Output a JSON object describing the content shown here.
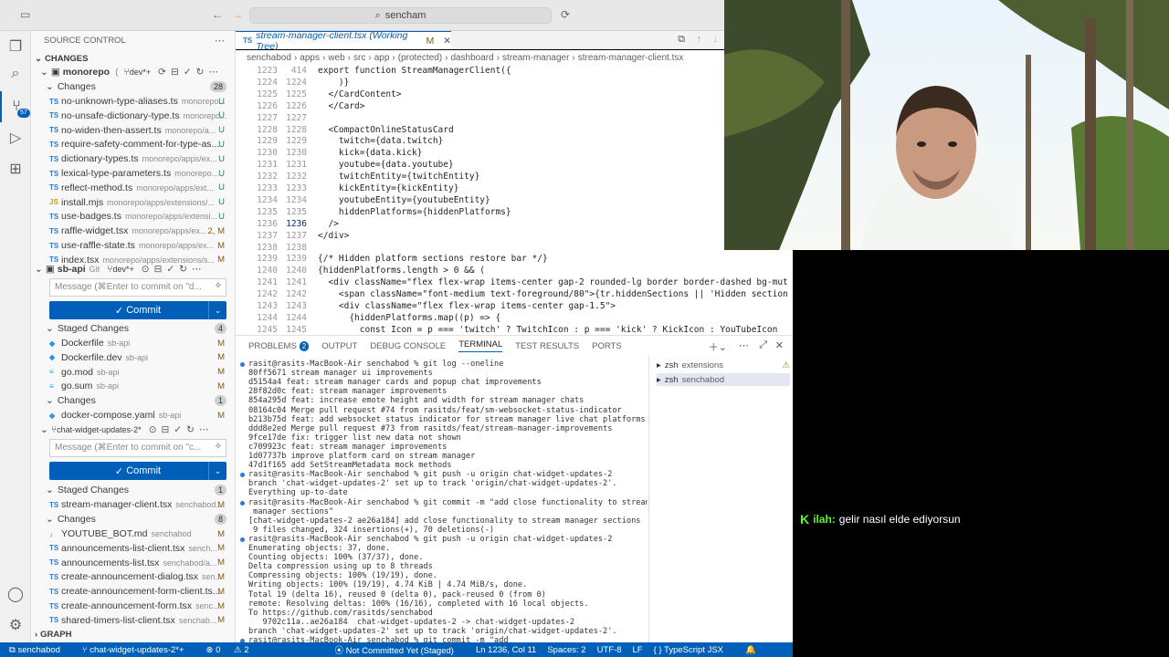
{
  "titlebar": {
    "search": "sencham"
  },
  "activity": {
    "badge": "57"
  },
  "sidebar": {
    "title": "SOURCE CONTROL",
    "changes_header": "CHANGES",
    "repo1": {
      "name": "monorepo",
      "branch": "dev*+"
    },
    "changes1_label": "Changes",
    "changes1_count": "28",
    "files1": [
      {
        "name": "no-unknown-type-aliases.ts",
        "path": "monorepo...",
        "status": "U",
        "icon": "TS"
      },
      {
        "name": "no-unsafe-dictionary-type.ts",
        "path": "monorepo...",
        "status": "U",
        "icon": "TS"
      },
      {
        "name": "no-widen-then-assert.ts",
        "path": "monorepo/a...",
        "status": "U",
        "icon": "TS"
      },
      {
        "name": "require-safety-comment-for-type-as...",
        "path": "",
        "status": "U",
        "icon": "TS"
      },
      {
        "name": "dictionary-types.ts",
        "path": "monorepo/apps/ex...",
        "status": "U",
        "icon": "TS"
      },
      {
        "name": "lexical-type-parameters.ts",
        "path": "monorepo...",
        "status": "U",
        "icon": "TS"
      },
      {
        "name": "reflect-method.ts",
        "path": "monorepo/apps/ext...",
        "status": "U",
        "icon": "TS"
      },
      {
        "name": "install.mjs",
        "path": "monorepo/apps/extensions/...",
        "status": "U",
        "icon": "JS"
      },
      {
        "name": "use-badges.ts",
        "path": "monorepo/apps/extensi...",
        "status": "U",
        "icon": "TS"
      },
      {
        "name": "raffle-widget.tsx",
        "path": "monorepo/apps/ex...",
        "status": "2, M",
        "icon": "TS"
      },
      {
        "name": "use-raffle-state.ts",
        "path": "monorepo/apps/ex...",
        "status": "M",
        "icon": "TS"
      },
      {
        "name": "index.tsx",
        "path": "monorepo/apps/extensions/s...",
        "status": "M",
        "icon": "TS"
      }
    ],
    "repo2": {
      "name": "sb-api",
      "vcs": "Git",
      "branch": "dev*+"
    },
    "message_placeholder1": "Message (⌘Enter to commit on \"d...",
    "commit_label": "Commit",
    "staged_label": "Staged Changes",
    "staged_count": "4",
    "staged_files": [
      {
        "name": "Dockerfile",
        "path": "sb-api",
        "status": "M",
        "icon": "dock"
      },
      {
        "name": "Dockerfile.dev",
        "path": "sb-api",
        "status": "M",
        "icon": "dock"
      },
      {
        "name": "go.mod",
        "path": "sb-api",
        "status": "M",
        "icon": "go"
      },
      {
        "name": "go.sum",
        "path": "sb-api",
        "status": "M",
        "icon": "go"
      }
    ],
    "changes2_label": "Changes",
    "changes2_count": "1",
    "files2": [
      {
        "name": "docker-compose.yaml",
        "path": "sb-api",
        "status": "M",
        "icon": "dock"
      }
    ],
    "repo3": {
      "name": "chat-widget-updates-2*"
    },
    "message_placeholder2": "Message (⌘Enter to commit on \"c...",
    "staged3_label": "Staged Changes",
    "staged3_count": "1",
    "staged3_files": [
      {
        "name": "stream-manager-client.tsx",
        "path": "senchabod...",
        "status": "M",
        "icon": "TS"
      }
    ],
    "changes3_label": "Changes",
    "changes3_count": "8",
    "files3": [
      {
        "name": "YOUTUBE_BOT.md",
        "path": "senchabod",
        "status": "M",
        "icon": "md"
      },
      {
        "name": "announcements-list-client.tsx",
        "path": "sench...",
        "status": "M",
        "icon": "TS"
      },
      {
        "name": "announcements-list.tsx",
        "path": "senchabod/a...",
        "status": "M",
        "icon": "TS"
      },
      {
        "name": "create-announcement-dialog.tsx",
        "path": "sen...",
        "status": "M",
        "icon": "TS"
      },
      {
        "name": "create-announcement-form-client.ts...",
        "path": "",
        "status": "M",
        "icon": "TS"
      },
      {
        "name": "create-announcement-form.tsx",
        "path": "senc...",
        "status": "M",
        "icon": "TS"
      },
      {
        "name": "shared-timers-list-client.tsx",
        "path": "senchab...",
        "status": "M",
        "icon": "TS"
      }
    ],
    "graph_label": "GRAPH"
  },
  "editor": {
    "tab_label": "stream-manager-client.tsx (Working Tree)",
    "tab_status": "M",
    "breadcrumb": [
      "senchabod",
      "apps",
      "web",
      "src",
      "app",
      "(protected)",
      "dashboard",
      "stream-manager",
      "stream-manager-client.tsx"
    ],
    "lines": [
      {
        "a": "1223",
        "b": "414",
        "t": "export function StreamManagerClient({"
      },
      {
        "a": "1224",
        "b": "1224",
        "t": "    )}"
      },
      {
        "a": "1225",
        "b": "1225",
        "t": "  </CardContent>"
      },
      {
        "a": "1226",
        "b": "1226",
        "t": "  </Card>"
      },
      {
        "a": "1227",
        "b": "1227",
        "t": ""
      },
      {
        "a": "1228",
        "b": "1228",
        "t": "  <CompactOnlineStatusCard"
      },
      {
        "a": "1229",
        "b": "1229",
        "t": "    twitch={data.twitch}"
      },
      {
        "a": "1230",
        "b": "1230",
        "t": "    kick={data.kick}"
      },
      {
        "a": "1231",
        "b": "1231",
        "t": "    youtube={data.youtube}"
      },
      {
        "a": "1232",
        "b": "1232",
        "t": "    twitchEntity={twitchEntity}"
      },
      {
        "a": "1233",
        "b": "1233",
        "t": "    kickEntity={kickEntity}"
      },
      {
        "a": "1234",
        "b": "1234",
        "t": "    youtubeEntity={youtubeEntity}"
      },
      {
        "a": "1235",
        "b": "1235",
        "t": "    hiddenPlatforms={hiddenPlatforms}"
      },
      {
        "a": "1236",
        "b": "1236",
        "t": "  />"
      },
      {
        "a": "1237",
        "b": "1237",
        "t": "</div>"
      },
      {
        "a": "1238",
        "b": "1238",
        "t": ""
      },
      {
        "a": "1239",
        "b": "1239",
        "t": "{/* Hidden platform sections restore bar */}"
      },
      {
        "a": "1240",
        "b": "1240",
        "t": "{hiddenPlatforms.length > 0 && ("
      },
      {
        "a": "1241",
        "b": "1241",
        "t": "  <div className=\"flex flex-wrap items-center gap-2 rounded-lg border border-dashed bg-mut"
      },
      {
        "a": "1242",
        "b": "1242",
        "t": "    <span className=\"font-medium text-foreground/80\">{tr.hiddenSections || 'Hidden section"
      },
      {
        "a": "1243",
        "b": "1243",
        "t": "    <div className=\"flex flex-wrap items-center gap-1.5\">"
      },
      {
        "a": "1244",
        "b": "1244",
        "t": "      {hiddenPlatforms.map((p) => {"
      },
      {
        "a": "1245",
        "b": "1245",
        "t": "        const Icon = p === 'twitch' ? TwitchIcon : p === 'kick' ? KickIcon : YouTubeIcon"
      }
    ]
  },
  "panel": {
    "tabs": [
      "PROBLEMS",
      "OUTPUT",
      "DEBUG CONSOLE",
      "TERMINAL",
      "TEST RESULTS",
      "PORTS"
    ],
    "problems_badge": "2",
    "terminal_lines": [
      "rasit@rasits-MacBook-Air senchabod % git log --oneline",
      "80ff5671 stream manager ui improvements",
      "d5154a4 feat: stream manager cards and popup chat improvements",
      "28f82d0c feat: stream manager improvements",
      "854a295d feat: increase emote height and width for stream manager chats",
      "08164c04 Merge pull request #74 from rasitds/feat/sm-websocket-status-indicator",
      "b213b75d feat: add websocket status indicator for stream manager live chat platforms",
      "ddd8e2ed Merge pull request #73 from rasitds/feat/stream-manager-improvements",
      "9fce17de fix: trigger list new data not shown",
      "c709923c feat: stream manager improvements",
      "1d07737b improve platform card on stream manager",
      "47d1f165 add SetStreamMetadata mock methods",
      "rasit@rasits-MacBook-Air senchabod % git push -u origin chat-widget-updates-2",
      "branch 'chat-widget-updates-2' set up to track 'origin/chat-widget-updates-2'.",
      "Everything up-to-date",
      "rasit@rasits-MacBook-Air senchabod % git commit -m \"add close functionality to stream",
      " manager sections\"",
      "[chat-widget-updates-2 ae26a184] add close functionality to stream manager sections",
      " 9 files changed, 324 insertions(+), 70 deletions(-)",
      "rasit@rasits-MacBook-Air senchabod % git push -u origin chat-widget-updates-2",
      "Enumerating objects: 37, done.",
      "Counting objects: 100% (37/37), done.",
      "Delta compression using up to 8 threads",
      "Compressing objects: 100% (19/19), done.",
      "Writing objects: 100% (19/19), 4.74 KiB | 4.74 MiB/s, done.",
      "Total 19 (delta 16), reused 0 (delta 0), pack-reused 0 (from 0)",
      "remote: Resolving deltas: 100% (16/16), completed with 16 local objects.",
      "To https://github.com/rasitds/senchabod",
      "   9702c11a..ae26a184  chat-widget-updates-2 -> chat-widget-updates-2",
      "branch 'chat-widget-updates-2' set up to track 'origin/chat-widget-updates-2'.",
      "rasit@rasits-MacBook-Air senchabod % git commit -m \"add "
    ],
    "terminals": [
      {
        "name": "zsh",
        "sub": "extensions"
      },
      {
        "name": "zsh",
        "sub": "senchabod"
      }
    ]
  },
  "status": {
    "remote": "senchabod",
    "branch": "chat-widget-updates-2*+",
    "problems": "0",
    "warnings": "2",
    "commit": "Not Committed Yet (Staged)",
    "position": "Ln 1236, Col 11",
    "spaces": "Spaces: 2",
    "encoding": "UTF-8",
    "eol": "LF",
    "lang": "TypeScript JSX"
  },
  "chat": {
    "user": "ilah:",
    "message": "gelir nasıl elde ediyorsun"
  },
  "colors": {
    "accent": "#005fb8",
    "chat_user": "#53fc18"
  }
}
